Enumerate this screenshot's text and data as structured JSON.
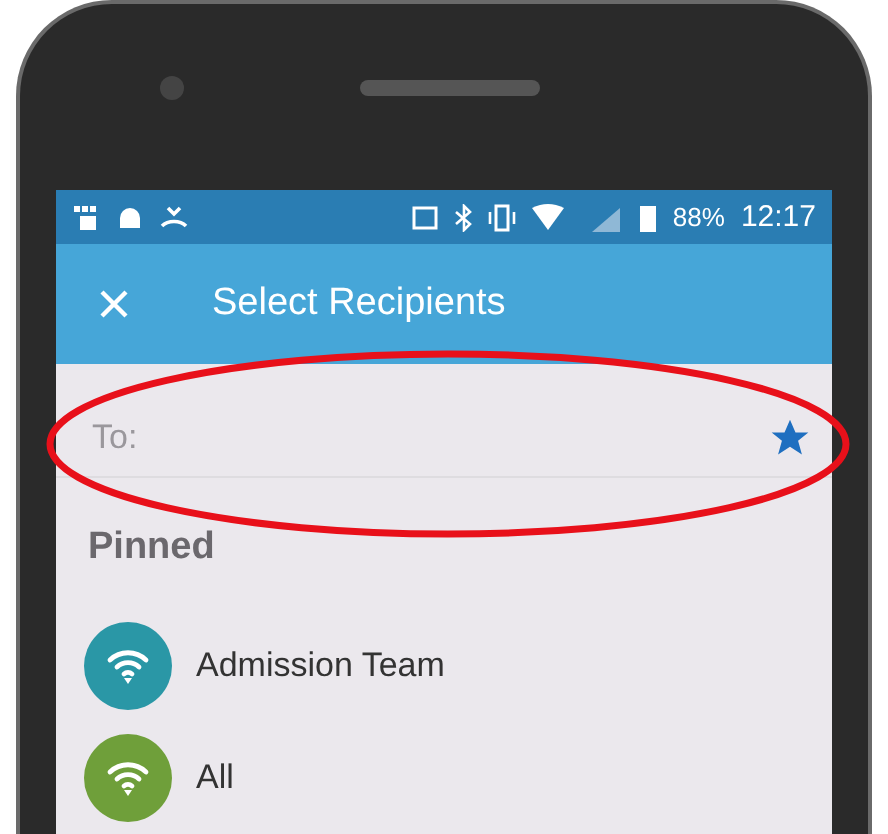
{
  "status_bar": {
    "battery": "88%",
    "time": "12:17"
  },
  "app_bar": {
    "title": "Select Recipients"
  },
  "recipient_field": {
    "placeholder": "To:"
  },
  "section_title": "Pinned",
  "items": [
    {
      "name": "Admission Team",
      "color": "#2a97a6"
    },
    {
      "name": "All",
      "color": "#6f9f3a"
    }
  ]
}
